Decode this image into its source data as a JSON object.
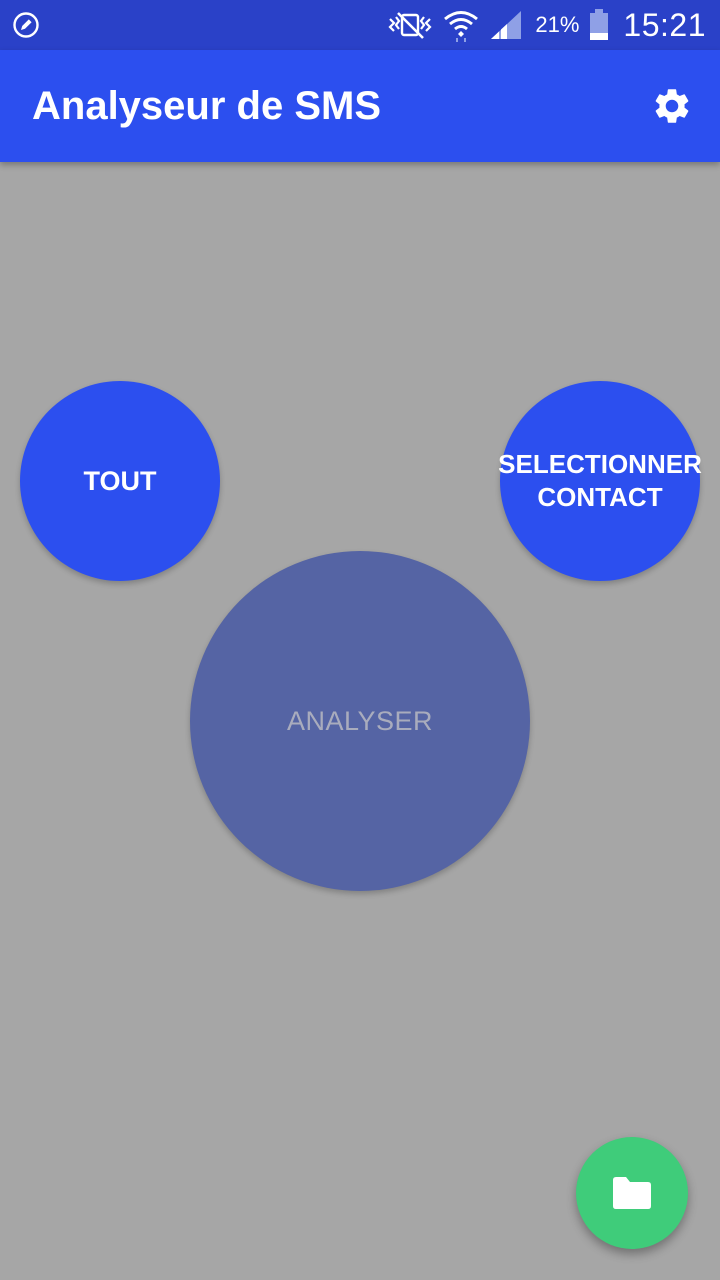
{
  "status_bar": {
    "left_icon": "edit-compass-icon",
    "icons": [
      "vibrate-mute-icon",
      "wifi-icon",
      "signal-icon",
      "battery-icon"
    ],
    "battery_percent": "21%",
    "time": "15:21"
  },
  "app_bar": {
    "title": "Analyseur de SMS",
    "settings_icon": "gear-icon"
  },
  "buttons": {
    "tout": "TOUT",
    "select_contact": "SELECTIONNER\nCONTACT",
    "analyser": "ANALYSER"
  },
  "fab": {
    "icon": "folder-icon"
  },
  "colors": {
    "status_bar": "#2a41c8",
    "app_bar": "#2c4fef",
    "background": "#a6a6a6",
    "primary_button": "#2c4fef",
    "disabled_button": "#5564a4",
    "fab": "#3fcc7a"
  }
}
